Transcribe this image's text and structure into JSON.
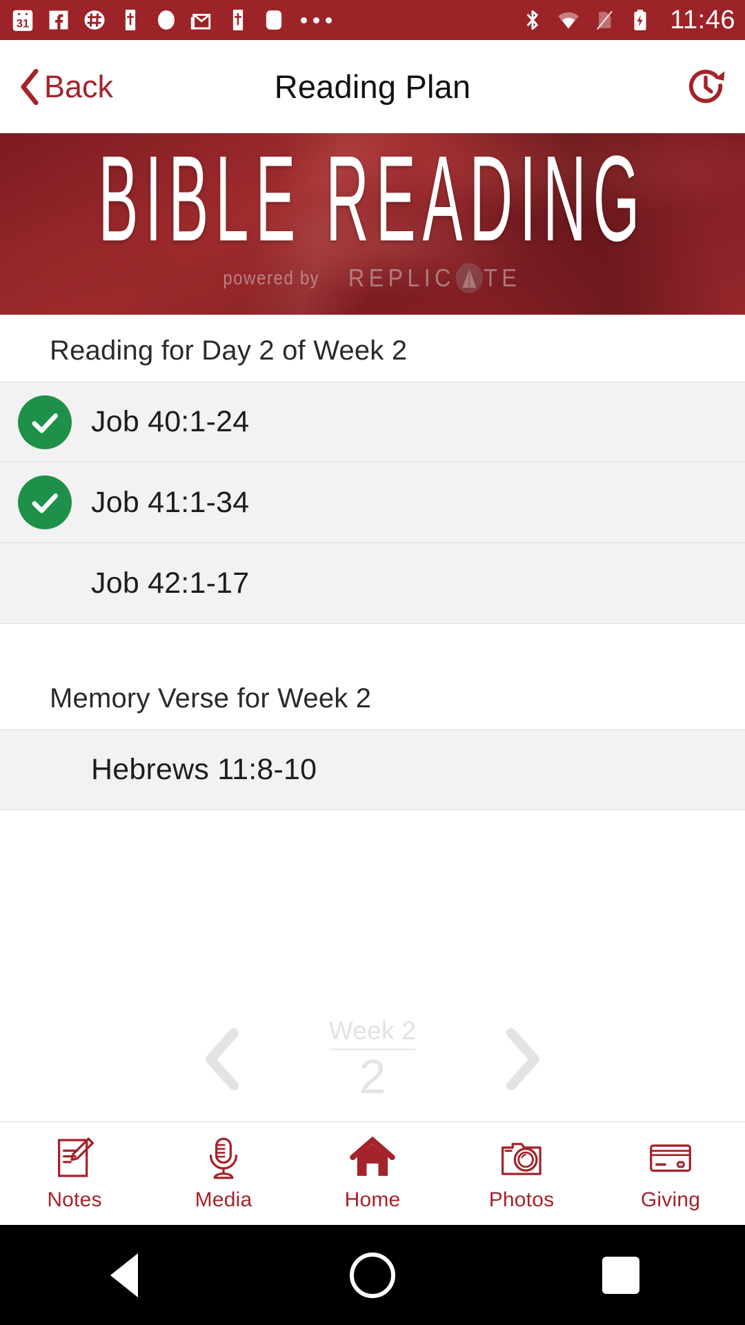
{
  "statusbar": {
    "time": "11:46",
    "left_icons": [
      "calendar-31-icon",
      "facebook-icon",
      "slack-icon",
      "bible-app-icon",
      "circle-app-icon",
      "gmail-icon",
      "bible-app-icon-2",
      "rounded-square-app-icon"
    ],
    "overflow": "more-notifications-icon",
    "right_icons": [
      "bluetooth-icon",
      "wifi-icon",
      "sim-off-icon",
      "battery-charging-icon"
    ],
    "bg_color": "#9C2327"
  },
  "navbar": {
    "back_label": "Back",
    "title": "Reading Plan",
    "back_icon": "chevron-left-icon",
    "action_icon": "history-clock-icon",
    "accent_color": "#A5232A"
  },
  "banner": {
    "title": "BIBLE READING",
    "powered_by": "powered by",
    "brand": "REPLIC",
    "brand_tail": "TE",
    "brand_mark": "replicate-logo-icon"
  },
  "reading_section": {
    "header": "Reading for Day 2 of Week 2",
    "items": [
      {
        "label": "Job 40:1-24",
        "completed": true
      },
      {
        "label": "Job 41:1-34",
        "completed": true
      },
      {
        "label": "Job 42:1-17",
        "completed": false
      }
    ]
  },
  "memory_section": {
    "header": "Memory Verse for Week 2",
    "items": [
      {
        "label": "Hebrews 11:8-10",
        "completed": false
      }
    ]
  },
  "pager": {
    "prev_icon": "chevron-left-icon",
    "next_icon": "chevron-right-icon",
    "week_label": "Week 2",
    "week_number": "2"
  },
  "tabbar": {
    "accent_color": "#A5232A",
    "tabs": [
      {
        "label": "Notes",
        "icon": "notes-icon"
      },
      {
        "label": "Media",
        "icon": "microphone-icon"
      },
      {
        "label": "Home",
        "icon": "home-icon"
      },
      {
        "label": "Photos",
        "icon": "camera-icon"
      },
      {
        "label": "Giving",
        "icon": "credit-card-icon"
      }
    ]
  },
  "androidnav": {
    "back": "android-back-icon",
    "home": "android-home-icon",
    "recents": "android-recents-icon"
  },
  "colors": {
    "red": "#9C2327",
    "accent": "#A5232A",
    "green": "#1E9049",
    "row_bg": "#F2F2F2"
  }
}
